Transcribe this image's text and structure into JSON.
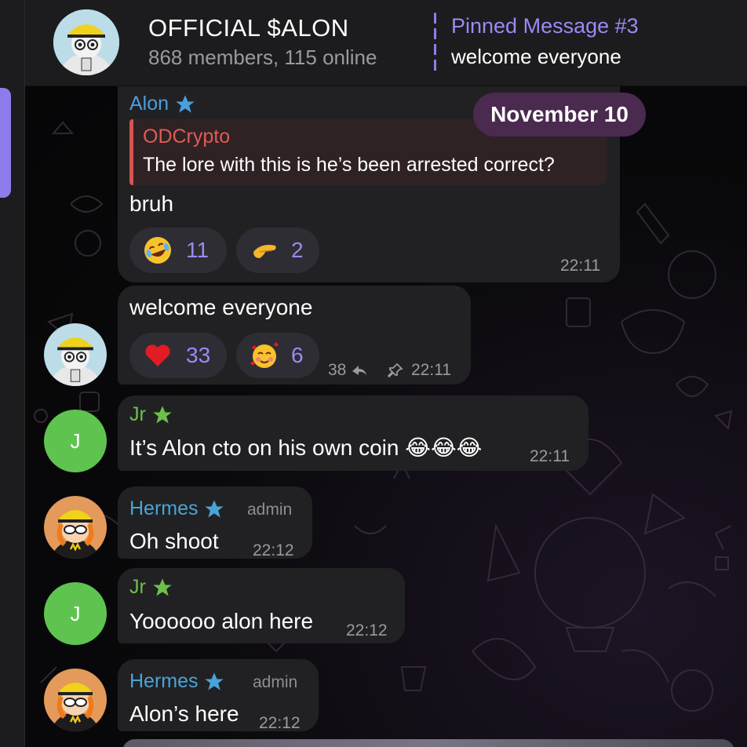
{
  "header": {
    "title": "OFFICIAL $ALON",
    "subtitle": "868 members, 115 online",
    "pinned_title": "Pinned Message #3",
    "pinned_text": "welcome everyone"
  },
  "date_pill": "November 10",
  "messages": [
    {
      "sender": "Alon",
      "role": "owner",
      "reply": {
        "name": "ODCrypto",
        "text": "The lore with this is he’s been arrested correct?"
      },
      "text": "bruh",
      "reactions": [
        {
          "emoji": "rolling-laughing-emoji",
          "count": "11"
        },
        {
          "emoji": "salute-hand-emoji",
          "count": "2"
        }
      ],
      "time": "22:11"
    },
    {
      "text": "welcome everyone",
      "reactions": [
        {
          "emoji": "red-heart-emoji",
          "count": "33"
        },
        {
          "emoji": "smiling-hearts-emoji",
          "count": "6"
        }
      ],
      "forwards": "38",
      "time": "22:11"
    },
    {
      "sender": "Jr",
      "avatar_letter": "J",
      "text": "It’s Alon cto on his own coin 😂😂😂",
      "time": "22:11"
    },
    {
      "sender": "Hermes",
      "role": "admin",
      "text": "Oh shoot",
      "time": "22:12"
    },
    {
      "sender": "Jr",
      "avatar_letter": "J",
      "text": "Yoooooo alon here",
      "time": "22:12"
    },
    {
      "sender": "Hermes",
      "role": "admin",
      "text": "Alon’s here",
      "time": "22:12"
    }
  ],
  "colors": {
    "accent": "#9b8af4",
    "alon_name": "#4a9ee0",
    "jr_name": "#6cc04a",
    "hermes_name": "#4aa3d6",
    "reply_name": "#e05b55",
    "bubble": "#212123",
    "header": "#1c1c1e"
  }
}
